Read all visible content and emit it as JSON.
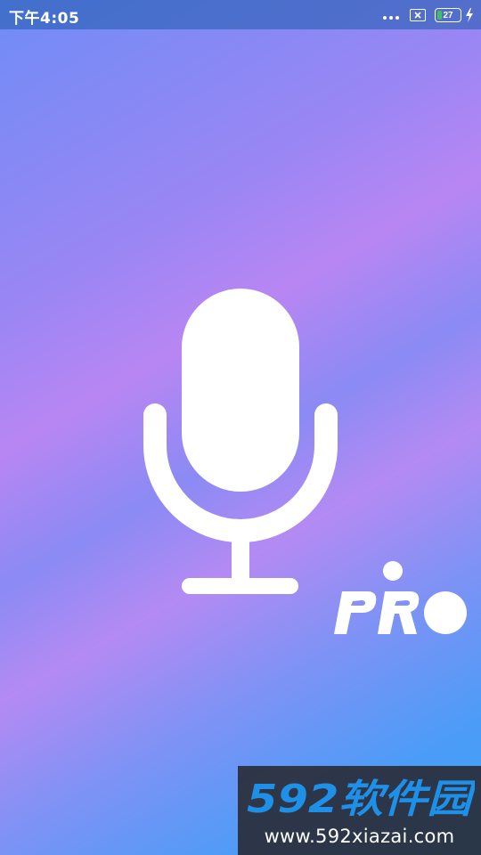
{
  "status_bar": {
    "time": "下午4:05",
    "battery_level": "27",
    "battery_fraction": 0.27,
    "icons": [
      "more-dots-icon",
      "no-sim-icon",
      "battery-icon",
      "charging-bolt-icon"
    ]
  },
  "splash": {
    "logo_icon": "microphone-icon",
    "badge_text": "PRO"
  },
  "watermark": {
    "brand": "592软件园",
    "url": "www.592xiazai.com"
  },
  "colors": {
    "gradient_top": "#6f8cf6",
    "gradient_mid": "#b886f3",
    "gradient_bottom": "#3aa2f8",
    "logo": "#ffffff",
    "watermark_bg": "#28282f",
    "watermark_accent": "#1e90e8"
  }
}
